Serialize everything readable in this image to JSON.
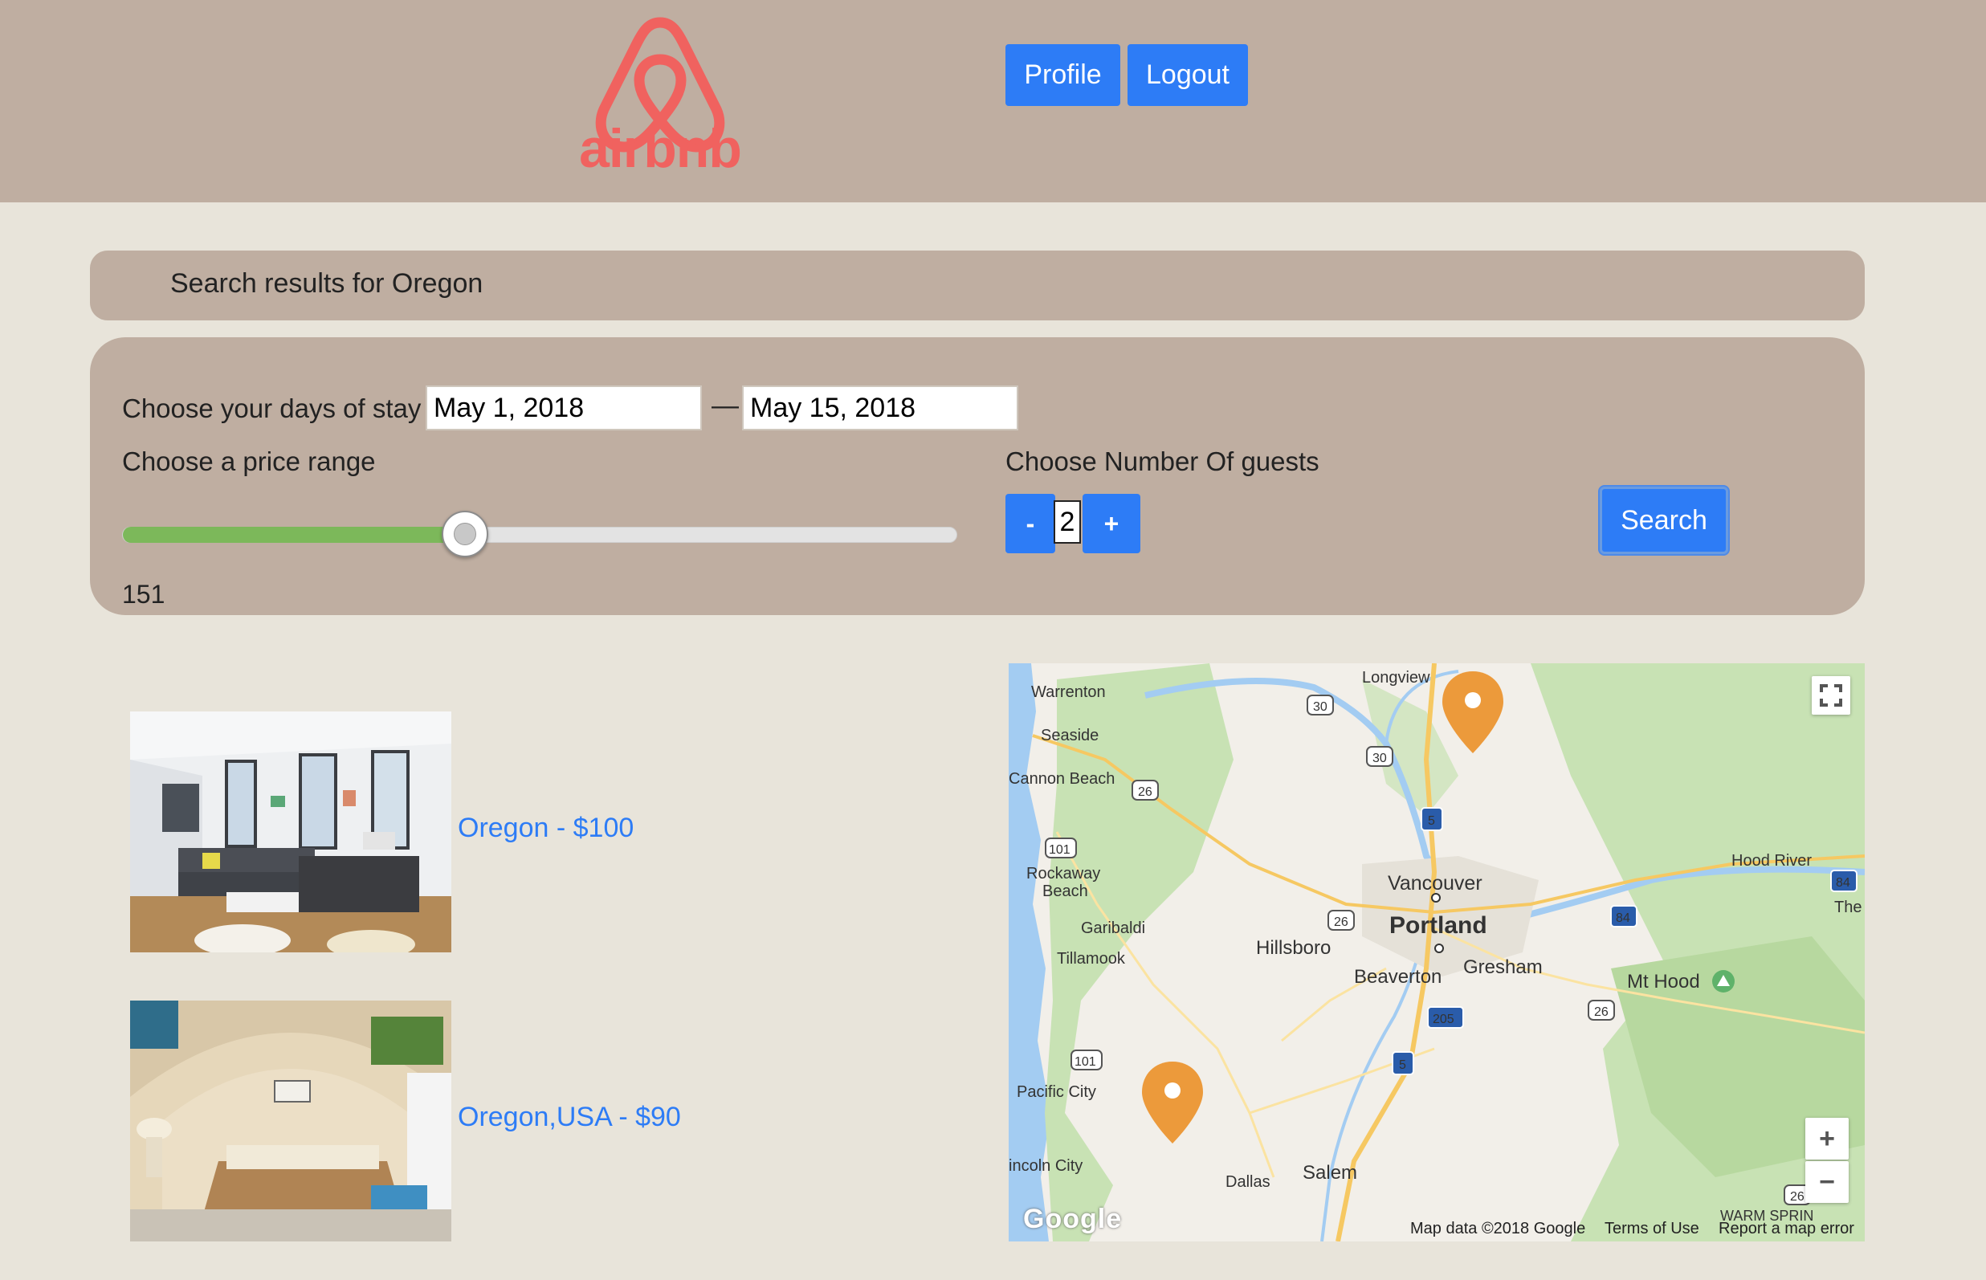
{
  "header": {
    "logo_text": "airbnb",
    "profile_label": "Profile",
    "logout_label": "Logout"
  },
  "results": {
    "text": "Search results for Oregon"
  },
  "filters": {
    "stay_label": "Choose your days of stay :",
    "start_date": "May 1, 2018",
    "date_separator": "—",
    "end_date": "May 15, 2018",
    "price_label": "Choose a price range",
    "price_value": "151",
    "price_fraction": 0.41,
    "guests_label": "Choose Number Of guests",
    "guests_minus": "-",
    "guests_count": "2",
    "guests_plus": "+",
    "search_label": "Search"
  },
  "listings": [
    {
      "title": "Oregon - $100"
    },
    {
      "title": "Oregon,USA - $90"
    }
  ],
  "map": {
    "cities": {
      "longview": "Longview",
      "warrenton": "Warrenton",
      "seaside": "Seaside",
      "cannon_beach": "Cannon Beach",
      "rockaway_beach": "Rockaway",
      "rockaway_beach2": "Beach",
      "garibaldi": "Garibaldi",
      "tillamook": "Tillamook",
      "vancouver": "Vancouver",
      "portland": "Portland",
      "hillsboro": "Hillsboro",
      "beaverton": "Beaverton",
      "gresham": "Gresham",
      "hood_river": "Hood River",
      "the": "The",
      "mt_hood": "Mt Hood",
      "pacific_city": "Pacific City",
      "lincoln_city": "incoln City",
      "dallas": "Dallas",
      "salem": "Salem",
      "warm_springs": "WARM SPRIN"
    },
    "shields": {
      "s30a": "30",
      "s30b": "30",
      "s26a": "26",
      "s101a": "101",
      "s26b": "26",
      "s84a": "84",
      "s84b": "84",
      "s26c": "26",
      "s101b": "101",
      "s26d": "26",
      "i5a": "5",
      "i205": "205",
      "i5b": "5"
    },
    "footer_data": "Map data ©2018 Google",
    "footer_terms": "Terms of Use",
    "footer_report": "Report a map error",
    "google_text": "Google",
    "zoom_in": "+",
    "zoom_out": "−",
    "marker_color": "#ec9a3b"
  },
  "colors": {
    "header_bg": "#bfaea1",
    "page_bg": "#e8e4da",
    "accent": "#2d7cf6",
    "brand": "#f0625f",
    "slider_fill": "#7cb85a"
  }
}
